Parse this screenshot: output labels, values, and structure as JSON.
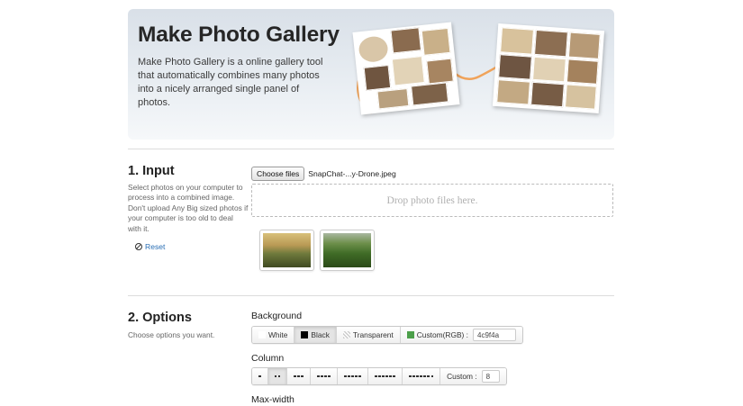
{
  "hero": {
    "title": "Make Photo Gallery",
    "description": "Make Photo Gallery is a online gallery tool that automatically combines many photos into a nicely arranged single panel of photos."
  },
  "input_section": {
    "title": "1. Input",
    "description": "Select photos on your computer to process into a combined image. Don't upload Any Big sized photos if your computer is too old to deal with it.",
    "reset_label": "Reset",
    "file_button": "Choose files",
    "file_name": "SnapChat-...y-Drone.jpeg",
    "dropzone_text": "Drop photo files here.",
    "thumbnails": [
      "landscape-sunrise",
      "green-hills"
    ]
  },
  "options_section": {
    "title": "2. Options",
    "description": "Choose options you want.",
    "background": {
      "label": "Background",
      "options": [
        {
          "label": "White",
          "swatch": "#ffffff"
        },
        {
          "label": "Black",
          "swatch": "#000000",
          "selected": true
        },
        {
          "label": "Transparent",
          "swatch": "checker"
        },
        {
          "label": "Custom(RGB) :",
          "swatch": "#4c9f4a"
        }
      ],
      "custom_value": "4c9f4a"
    },
    "column": {
      "label": "Column",
      "options": [
        1,
        2,
        3,
        4,
        5,
        6,
        7
      ],
      "selected": 2,
      "custom_label": "Custom :",
      "custom_value": "8"
    },
    "max_width": {
      "label": "Max-width"
    }
  }
}
